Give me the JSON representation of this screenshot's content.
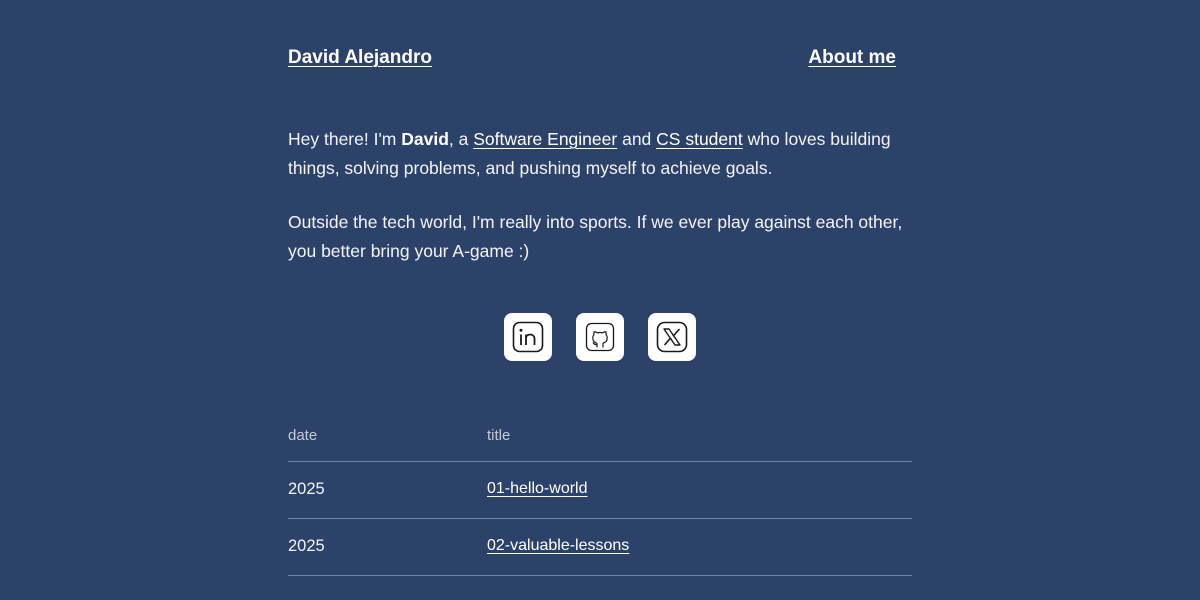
{
  "header": {
    "brand": "David Alejandro",
    "about_link": "About me"
  },
  "intro": {
    "p1": {
      "t1": "Hey there! I'm ",
      "name": "David",
      "t2": ", a ",
      "link1": "Software Engineer",
      "t3": " and ",
      "link2": "CS student",
      "t4": " who loves building things, solving problems, and pushing myself to achieve goals."
    },
    "p2": "Outside the tech world, I'm really into sports. If we ever play against each other, you better bring your A-game :)"
  },
  "socials": [
    {
      "icon": "linkedin-icon"
    },
    {
      "icon": "github-icon"
    },
    {
      "icon": "x-twitter-icon"
    }
  ],
  "posts": {
    "columns": [
      "date",
      "title"
    ],
    "rows": [
      {
        "date": "2025",
        "title": "01-hello-world"
      },
      {
        "date": "2025",
        "title": "02-valuable-lessons"
      }
    ]
  },
  "colors": {
    "background": "#2d4269",
    "text": "#f2f4f8",
    "divider": "#7085a8"
  }
}
